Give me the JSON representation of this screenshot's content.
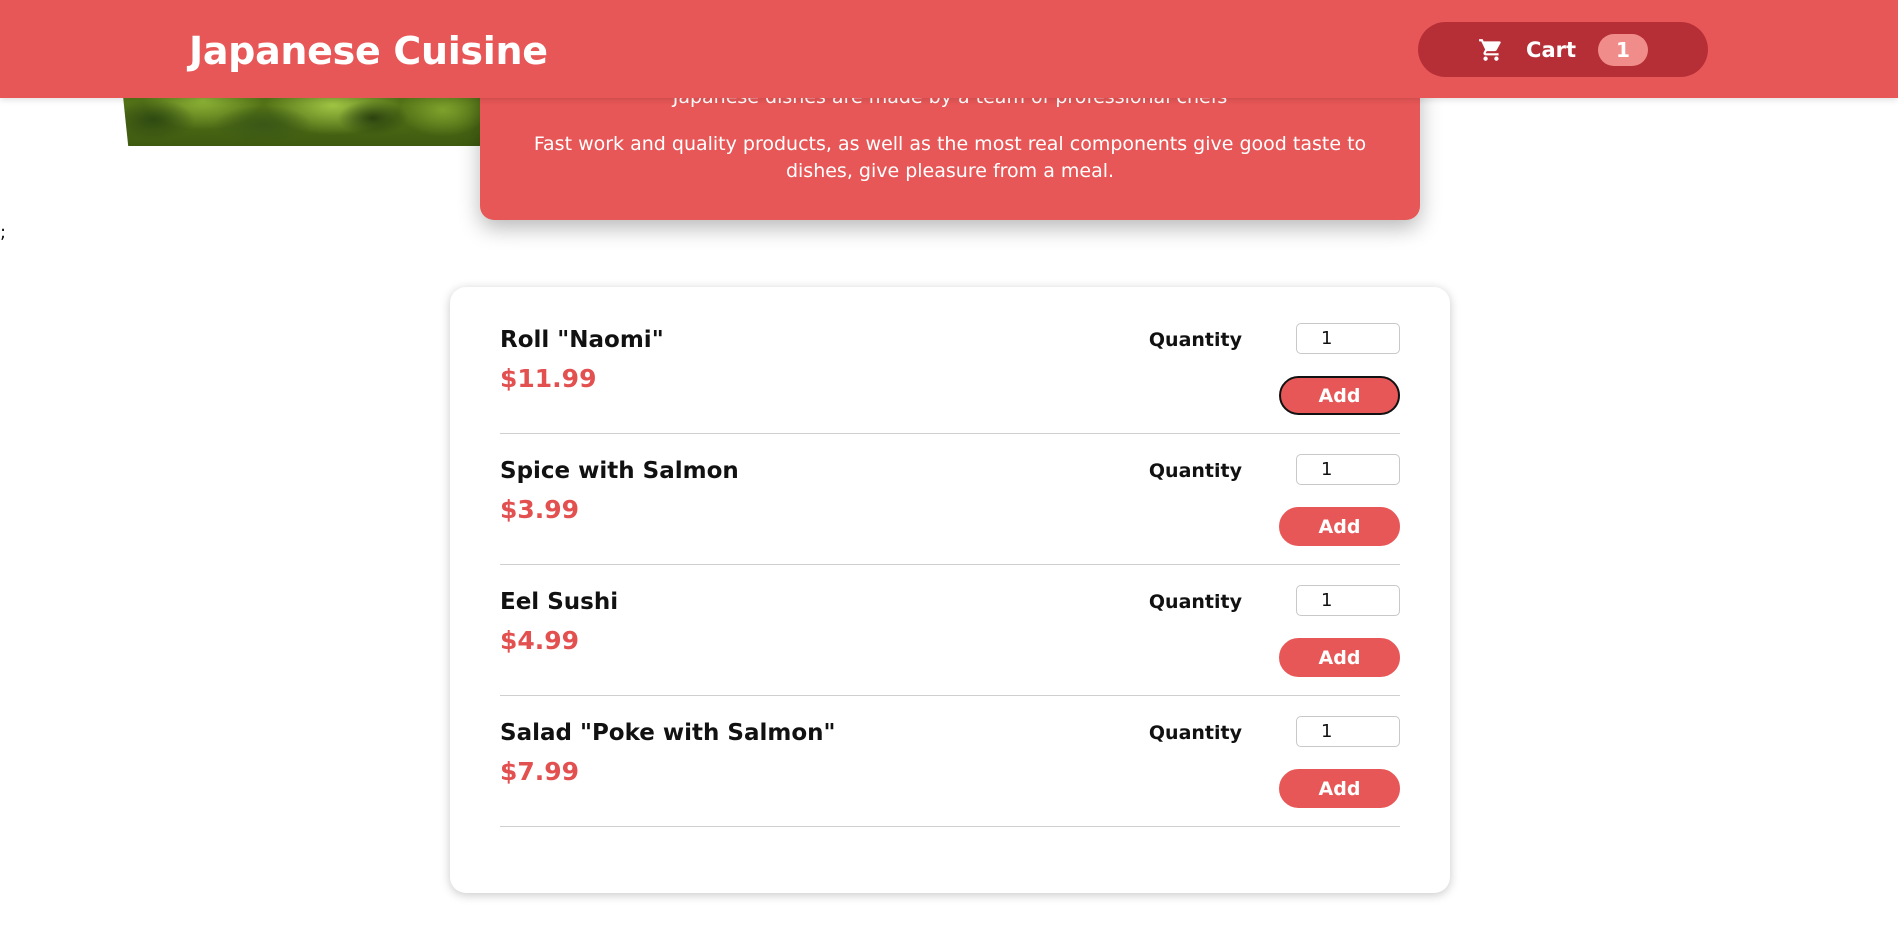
{
  "header": {
    "title": "Japanese Cuisine",
    "cart": {
      "label": "Cart",
      "icon": "cart-icon",
      "count": "1"
    }
  },
  "summary": {
    "paragraphs": [
      "Japanese dishes are made by a team of professional chefs",
      "Fast work and quality products, as well as the most real components give good taste to dishes, give pleasure from a meal."
    ]
  },
  "stray_text": ";",
  "meals": [
    {
      "name": "Roll \"Naomi\"",
      "price": "$11.99",
      "quantity_label": "Quantity",
      "quantity": "1",
      "add_label": "Add"
    },
    {
      "name": "Spice with Salmon",
      "price": "$3.99",
      "quantity_label": "Quantity",
      "quantity": "1",
      "add_label": "Add"
    },
    {
      "name": "Eel Sushi",
      "price": "$4.99",
      "quantity_label": "Quantity",
      "quantity": "1",
      "add_label": "Add"
    },
    {
      "name": "Salad \"Poke with Salmon\"",
      "price": "$7.99",
      "quantity_label": "Quantity",
      "quantity": "1",
      "add_label": "Add"
    }
  ],
  "colors": {
    "accent": "#e85757",
    "cart_button": "#b62f37",
    "cart_badge": "#f08d8a",
    "price": "#e35050"
  }
}
